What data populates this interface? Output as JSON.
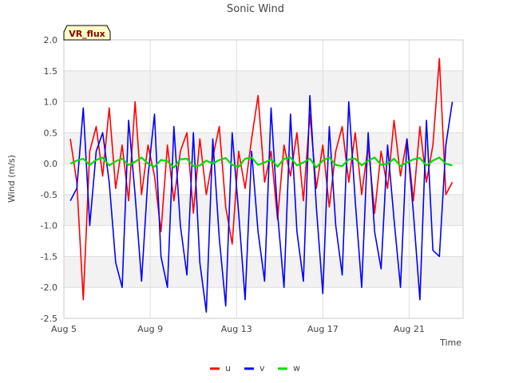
{
  "chart_data": {
    "type": "line",
    "title": "Sonic Wind",
    "badge": "VR_flux",
    "xlabel": "Time",
    "ylabel": "Wind (m/s)",
    "ylim": [
      -2.5,
      2.0
    ],
    "yticks": [
      -2.5,
      -2.0,
      -1.5,
      -1.0,
      -0.5,
      0.0,
      0.5,
      1.0,
      1.5,
      2.0
    ],
    "ytick_labels": [
      "-2.5",
      "-2.0",
      "-1.5",
      "-1.0",
      "-0.5",
      "0.0",
      "0.5",
      "1.0",
      "1.5",
      "2.0"
    ],
    "xlim": [
      5.0,
      23.5
    ],
    "xticks": [
      5,
      9,
      13,
      17,
      21
    ],
    "xtick_labels": [
      "Aug 5",
      "Aug 9",
      "Aug 13",
      "Aug 17",
      "Aug 21"
    ],
    "legend_position": "bottom-center",
    "grid": true,
    "series": [
      {
        "name": "u",
        "color": "#ff0000",
        "x": [
          5.3,
          5.6,
          5.9,
          6.2,
          6.5,
          6.8,
          7.1,
          7.4,
          7.7,
          8.0,
          8.3,
          8.6,
          8.9,
          9.2,
          9.5,
          9.8,
          10.1,
          10.4,
          10.7,
          11.0,
          11.3,
          11.6,
          11.9,
          12.2,
          12.5,
          12.8,
          13.1,
          13.4,
          13.7,
          14.0,
          14.3,
          14.6,
          14.9,
          15.2,
          15.5,
          15.8,
          16.1,
          16.4,
          16.7,
          17.0,
          17.3,
          17.6,
          17.9,
          18.2,
          18.5,
          18.8,
          19.1,
          19.4,
          19.7,
          20.0,
          20.3,
          20.6,
          20.9,
          21.2,
          21.5,
          21.8,
          22.1,
          22.4,
          22.7,
          23.0
        ],
        "y": [
          0.4,
          -0.3,
          -2.2,
          0.2,
          0.6,
          -0.2,
          0.9,
          -0.4,
          0.3,
          -0.6,
          1.0,
          -0.5,
          0.3,
          -0.2,
          -1.1,
          0.3,
          -0.6,
          0.2,
          0.5,
          -0.8,
          0.4,
          -0.5,
          0.1,
          0.6,
          -0.7,
          -1.3,
          0.2,
          -0.4,
          0.4,
          1.1,
          -0.3,
          0.2,
          -0.9,
          0.3,
          -0.2,
          0.5,
          -0.6,
          0.8,
          -0.4,
          0.3,
          -0.7,
          0.2,
          0.6,
          -0.3,
          0.5,
          -0.5,
          0.3,
          -0.8,
          0.2,
          -0.4,
          0.7,
          -0.2,
          0.4,
          -0.6,
          0.6,
          -0.3,
          0.3,
          1.7,
          -0.5,
          -0.3
        ]
      },
      {
        "name": "v",
        "color": "#0000ff",
        "x": [
          5.3,
          5.6,
          5.9,
          6.2,
          6.5,
          6.8,
          7.1,
          7.4,
          7.7,
          8.0,
          8.3,
          8.6,
          8.9,
          9.2,
          9.5,
          9.8,
          10.1,
          10.4,
          10.7,
          11.0,
          11.3,
          11.6,
          11.9,
          12.2,
          12.5,
          12.8,
          13.1,
          13.4,
          13.7,
          14.0,
          14.3,
          14.6,
          14.9,
          15.2,
          15.5,
          15.8,
          16.1,
          16.4,
          16.7,
          17.0,
          17.3,
          17.6,
          17.9,
          18.2,
          18.5,
          18.8,
          19.1,
          19.4,
          19.7,
          20.0,
          20.3,
          20.6,
          20.9,
          21.2,
          21.5,
          21.8,
          22.1,
          22.4,
          22.7,
          23.0
        ],
        "y": [
          -0.6,
          -0.4,
          0.9,
          -1.0,
          0.2,
          0.5,
          -0.3,
          -1.6,
          -2.0,
          0.7,
          -0.5,
          -1.9,
          -0.2,
          0.8,
          -1.5,
          -2.0,
          0.6,
          -1.0,
          -1.8,
          0.5,
          -1.6,
          -2.4,
          0.4,
          -1.2,
          -2.3,
          0.5,
          -0.8,
          -2.2,
          0.2,
          -1.1,
          -1.9,
          0.9,
          -0.8,
          -2.0,
          0.8,
          -1.1,
          -1.9,
          1.1,
          -0.7,
          -2.1,
          0.6,
          -1.0,
          -1.8,
          1.0,
          -0.6,
          -2.0,
          0.5,
          -1.1,
          -1.7,
          0.3,
          -0.9,
          -2.0,
          0.4,
          -0.8,
          -2.2,
          0.7,
          -1.4,
          -1.5,
          0.3,
          1.0
        ]
      },
      {
        "name": "w",
        "color": "#00dd00",
        "x": [
          5.3,
          5.6,
          5.9,
          6.2,
          6.5,
          6.8,
          7.1,
          7.4,
          7.7,
          8.0,
          8.3,
          8.6,
          8.9,
          9.2,
          9.5,
          9.8,
          10.1,
          10.4,
          10.7,
          11.0,
          11.3,
          11.6,
          11.9,
          12.2,
          12.5,
          12.8,
          13.1,
          13.4,
          13.7,
          14.0,
          14.3,
          14.6,
          14.9,
          15.2,
          15.5,
          15.8,
          16.1,
          16.4,
          16.7,
          17.0,
          17.3,
          17.6,
          17.9,
          18.2,
          18.5,
          18.8,
          19.1,
          19.4,
          19.7,
          20.0,
          20.3,
          20.6,
          20.9,
          21.2,
          21.5,
          21.8,
          22.1,
          22.4,
          22.7,
          23.0
        ],
        "y": [
          0.0,
          0.05,
          0.08,
          -0.02,
          0.06,
          0.1,
          -0.03,
          0.04,
          0.08,
          -0.02,
          0.03,
          0.1,
          0.0,
          -0.05,
          0.06,
          0.04,
          -0.06,
          0.07,
          0.08,
          -0.04,
          -0.03,
          0.05,
          0.0,
          0.06,
          0.09,
          -0.02,
          -0.05,
          0.08,
          0.1,
          -0.02,
          0.02,
          0.07,
          -0.05,
          0.08,
          0.1,
          -0.03,
          0.02,
          0.08,
          -0.06,
          0.05,
          0.1,
          -0.02,
          -0.04,
          0.07,
          0.08,
          -0.03,
          0.05,
          0.1,
          -0.02,
          0.0,
          0.08,
          -0.04,
          0.02,
          0.07,
          0.09,
          -0.03,
          0.05,
          0.1,
          0.0,
          -0.03
        ]
      }
    ]
  }
}
